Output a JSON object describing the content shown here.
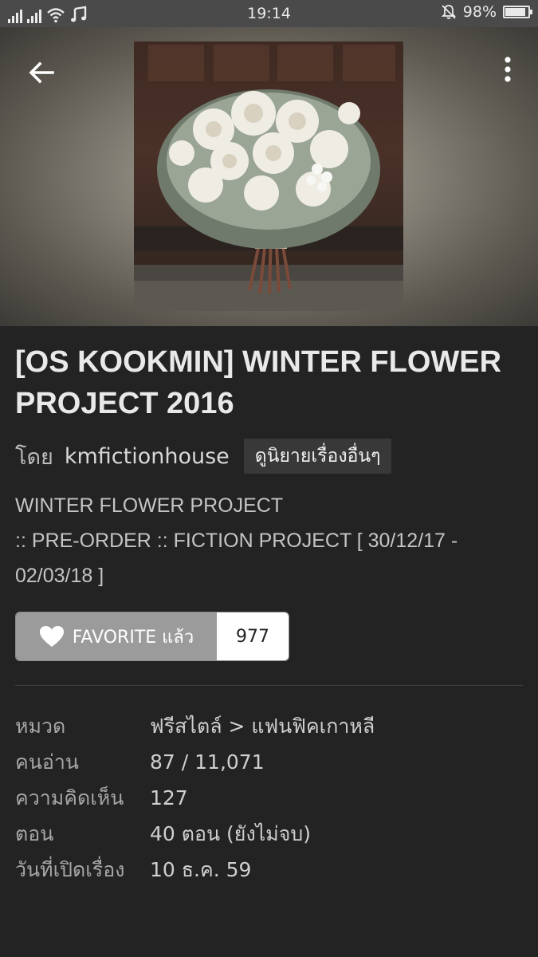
{
  "status_bar": {
    "time": "19:14",
    "battery": "98%",
    "battery_level": 0.98,
    "icons": [
      "signal-icon",
      "signal-icon",
      "wifi-icon",
      "music-note-icon",
      "bell-muted-icon",
      "battery-icon"
    ]
  },
  "header": {
    "back_icon": "arrow-left-icon",
    "more_icon": "more-vert-icon"
  },
  "story": {
    "title": "[OS KOOKMIN] WINTER FLOWER PROJECT 2016",
    "author_prefix": "โดย",
    "author": "kmfictionhouse",
    "other_stories_label": "ดูนิยายเรื่องอื่นๆ",
    "description_lines": [
      "WINTER FLOWER PROJECT",
      ":: PRE-ORDER :: FICTION PROJECT [ 30/12/17 -",
      "02/03/18 ]"
    ]
  },
  "favorite": {
    "label": "FAVORITE แล้ว",
    "count": "977",
    "icon": "heart-icon"
  },
  "info": [
    {
      "label": "หมวด",
      "value": "ฟรีสไตล์ > แฟนฟิคเกาหลี"
    },
    {
      "label": "คนอ่าน",
      "value": "87 / 11,071"
    },
    {
      "label": "ความคิดเห็น",
      "value": "127"
    },
    {
      "label": "ตอน",
      "value": "40 ตอน (ยังไม่จบ)"
    },
    {
      "label": "วันที่เปิดเรื่อง",
      "value": "10 ธ.ค. 59"
    }
  ],
  "colors": {
    "background": "#232323",
    "status_bar": "#4a4a4a",
    "favorite_button": "#9b9b9b"
  }
}
